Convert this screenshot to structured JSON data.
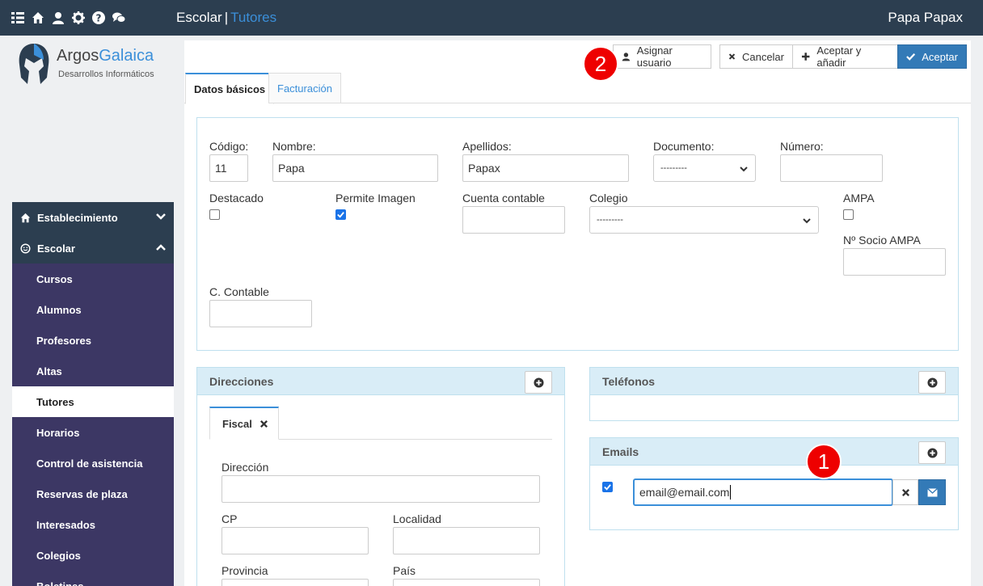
{
  "header": {
    "app_name": "Escolar",
    "separator": "|",
    "section": "Tutores",
    "user_name": "Papa Papax",
    "icons": [
      "list-icon",
      "home-icon",
      "user-icon",
      "gear-icon",
      "help-icon",
      "chat-icon"
    ]
  },
  "logo": {
    "brand_first": "Argos",
    "brand_second": "Galaica",
    "tagline": "Desarrollos Informáticos"
  },
  "sidebar": {
    "sections": [
      {
        "label": "Establecimiento",
        "expanded": false
      },
      {
        "label": "Escolar",
        "expanded": true
      }
    ],
    "items": [
      {
        "label": "Cursos"
      },
      {
        "label": "Alumnos"
      },
      {
        "label": "Profesores"
      },
      {
        "label": "Altas"
      },
      {
        "label": "Tutores",
        "active": true
      },
      {
        "label": "Horarios"
      },
      {
        "label": "Control de asistencia"
      },
      {
        "label": "Reservas de plaza"
      },
      {
        "label": "Interesados"
      },
      {
        "label": "Colegios"
      },
      {
        "label": "Boletines"
      }
    ]
  },
  "toolbar": {
    "assign_user": "Asignar usuario",
    "cancel": "Cancelar",
    "accept_add": "Aceptar y añadir",
    "accept": "Aceptar"
  },
  "annotations": {
    "badge_1": "1",
    "badge_2": "2"
  },
  "tabs": [
    {
      "label": "Datos básicos",
      "active": true
    },
    {
      "label": "Facturación",
      "active": false
    }
  ],
  "form": {
    "codigo": {
      "label": "Código:",
      "value": "11"
    },
    "nombre": {
      "label": "Nombre:",
      "value": "Papa"
    },
    "apellidos": {
      "label": "Apellidos:",
      "value": "Papax"
    },
    "documento": {
      "label": "Documento:",
      "selected": "---------"
    },
    "numero": {
      "label": "Número:",
      "value": ""
    },
    "destacado": {
      "label": "Destacado",
      "checked": false
    },
    "permite_imagen": {
      "label": "Permite Imagen",
      "checked": true
    },
    "cuenta_contable": {
      "label": "Cuenta contable",
      "value": ""
    },
    "colegio": {
      "label": "Colegio",
      "selected": "---------"
    },
    "ampa": {
      "label": "AMPA",
      "checked": false
    },
    "socio_ampa": {
      "label": "Nº Socio AMPA",
      "value": ""
    },
    "c_contable": {
      "label": "C. Contable",
      "value": ""
    }
  },
  "direcciones": {
    "title": "Direcciones",
    "tab": "Fiscal",
    "direccion": {
      "label": "Dirección",
      "value": ""
    },
    "cp": {
      "label": "CP",
      "value": ""
    },
    "localidad": {
      "label": "Localidad",
      "value": ""
    },
    "provincia": {
      "label": "Provincia",
      "value": ""
    },
    "pais": {
      "label": "País",
      "value": ""
    }
  },
  "telefonos": {
    "title": "Teléfonos"
  },
  "emails": {
    "title": "Emails",
    "entries": [
      {
        "checked": true,
        "value": "email@email.com"
      }
    ]
  },
  "colors": {
    "topbar": "#2c3e50",
    "menu_item": "#3c3764",
    "accent": "#3b8fd9",
    "primary": "#337ab7",
    "badge": "#ee0000",
    "panel_head": "#d9edf7"
  }
}
